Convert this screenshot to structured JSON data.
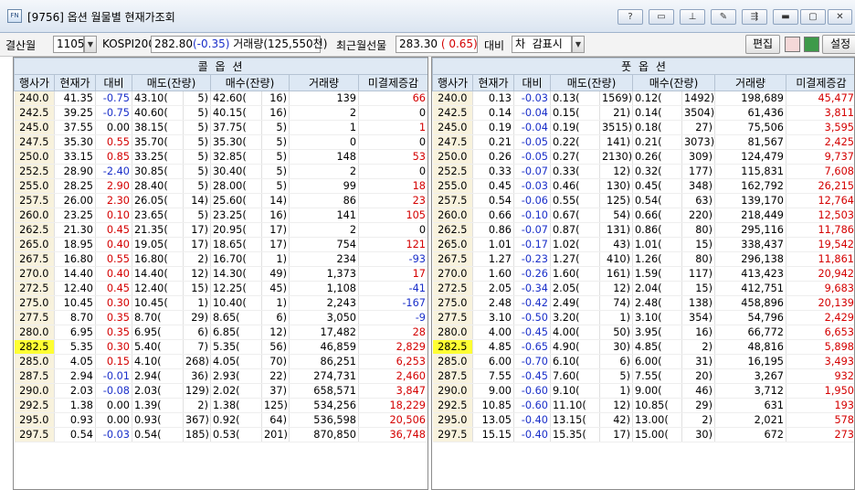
{
  "window": {
    "title": "[9756] 옵션 월물별 현재가조회",
    "app_icon": "window-app-icon"
  },
  "titlebar_buttons": [
    {
      "name": "help",
      "glyph": "?"
    },
    {
      "name": "window",
      "glyph": "▭"
    },
    {
      "name": "pin",
      "glyph": "⊥"
    },
    {
      "name": "tool",
      "glyph": "✎"
    },
    {
      "name": "link",
      "glyph": "⇶"
    },
    {
      "name": "minimize",
      "glyph": "▬"
    },
    {
      "name": "maximize",
      "glyph": "▢"
    },
    {
      "name": "close",
      "glyph": "✕"
    }
  ],
  "toolbar": {
    "expiry_label": "결산월",
    "expiry_value": "1105",
    "kospi_label": "KOSPI200",
    "kospi_value": "282.80",
    "kospi_change": "(-0.35)",
    "kospi_volume": "거래량(125,550천)",
    "nearby_futures_label": "최근월선물",
    "futures_value": "283.30",
    "futures_change": "( 0.65)",
    "compare_label": "대비",
    "compare_mode": "차",
    "display_mode": "감표시",
    "edit_button": "편집",
    "settings_button": "설정"
  },
  "call_banner": "콜 옵 션",
  "put_banner": "풋 옵 션",
  "call_headers": [
    "행사가",
    "현재가",
    "대비",
    "매도(잔량)",
    "매수(잔량)",
    "거래량",
    "미결제증감"
  ],
  "put_headers": [
    "행사가",
    "현재가",
    "대비",
    "매도(잔량)",
    "매수(잔량)",
    "거래량",
    "미결제증감"
  ],
  "atm_strike": "282.5",
  "colors": {
    "up": "#d40000",
    "down": "#1a2fc9",
    "atm_highlight": "#ffff33",
    "strike_bg": "#f8f2dd",
    "header_bg": "#dde8f4"
  },
  "call_rows": [
    [
      "240.0",
      "41.35",
      "-0.75",
      "43.10(",
      "5)",
      "42.60(",
      "16)",
      "139",
      "66"
    ],
    [
      "242.5",
      "39.25",
      "-0.75",
      "40.60(",
      "5)",
      "40.15(",
      "16)",
      "2",
      "0"
    ],
    [
      "245.0",
      "37.55",
      "0.00",
      "38.15(",
      "5)",
      "37.75(",
      "5)",
      "1",
      "1"
    ],
    [
      "247.5",
      "35.30",
      "0.55",
      "35.70(",
      "5)",
      "35.30(",
      "5)",
      "0",
      "0"
    ],
    [
      "250.0",
      "33.15",
      "0.85",
      "33.25(",
      "5)",
      "32.85(",
      "5)",
      "148",
      "53"
    ],
    [
      "252.5",
      "28.90",
      "-2.40",
      "30.85(",
      "5)",
      "30.40(",
      "5)",
      "2",
      "0"
    ],
    [
      "255.0",
      "28.25",
      "2.90",
      "28.40(",
      "5)",
      "28.00(",
      "5)",
      "99",
      "18"
    ],
    [
      "257.5",
      "26.00",
      "2.30",
      "26.05(",
      "14)",
      "25.60(",
      "14)",
      "86",
      "23"
    ],
    [
      "260.0",
      "23.25",
      "0.10",
      "23.65(",
      "5)",
      "23.25(",
      "16)",
      "141",
      "105"
    ],
    [
      "262.5",
      "21.30",
      "0.45",
      "21.35(",
      "17)",
      "20.95(",
      "17)",
      "2",
      "0"
    ],
    [
      "265.0",
      "18.95",
      "0.40",
      "19.05(",
      "17)",
      "18.65(",
      "17)",
      "754",
      "121"
    ],
    [
      "267.5",
      "16.80",
      "0.55",
      "16.80(",
      "2)",
      "16.70(",
      "1)",
      "234",
      "-93"
    ],
    [
      "270.0",
      "14.40",
      "0.40",
      "14.40(",
      "12)",
      "14.30(",
      "49)",
      "1,373",
      "17"
    ],
    [
      "272.5",
      "12.40",
      "0.45",
      "12.40(",
      "15)",
      "12.25(",
      "45)",
      "1,108",
      "-41"
    ],
    [
      "275.0",
      "10.45",
      "0.30",
      "10.45(",
      "1)",
      "10.40(",
      "1)",
      "2,243",
      "-167"
    ],
    [
      "277.5",
      "8.70",
      "0.35",
      "8.70(",
      "29)",
      "8.65(",
      "6)",
      "3,050",
      "-9"
    ],
    [
      "280.0",
      "6.95",
      "0.35",
      "6.95(",
      "6)",
      "6.85(",
      "12)",
      "17,482",
      "28"
    ],
    [
      "282.5",
      "5.35",
      "0.30",
      "5.40(",
      "7)",
      "5.35(",
      "56)",
      "46,859",
      "2,829"
    ],
    [
      "285.0",
      "4.05",
      "0.15",
      "4.10(",
      "268)",
      "4.05(",
      "70)",
      "86,251",
      "6,253"
    ],
    [
      "287.5",
      "2.94",
      "-0.01",
      "2.94(",
      "36)",
      "2.93(",
      "22)",
      "274,731",
      "2,460"
    ],
    [
      "290.0",
      "2.03",
      "-0.08",
      "2.03(",
      "129)",
      "2.02(",
      "37)",
      "658,571",
      "3,847"
    ],
    [
      "292.5",
      "1.38",
      "0.00",
      "1.39(",
      "2)",
      "1.38(",
      "125)",
      "534,256",
      "18,229"
    ],
    [
      "295.0",
      "0.93",
      "0.00",
      "0.93(",
      "367)",
      "0.92(",
      "64)",
      "536,598",
      "20,506"
    ],
    [
      "297.5",
      "0.54",
      "-0.03",
      "0.54(",
      "185)",
      "0.53(",
      "201)",
      "870,850",
      "36,748"
    ]
  ],
  "put_rows": [
    [
      "240.0",
      "0.13",
      "-0.03",
      "0.13(",
      "1569)",
      "0.12(",
      "1492)",
      "198,689",
      "45,477"
    ],
    [
      "242.5",
      "0.14",
      "-0.04",
      "0.15(",
      "21)",
      "0.14(",
      "3504)",
      "61,436",
      "3,811"
    ],
    [
      "245.0",
      "0.19",
      "-0.04",
      "0.19(",
      "3515)",
      "0.18(",
      "27)",
      "75,506",
      "3,595"
    ],
    [
      "247.5",
      "0.21",
      "-0.05",
      "0.22(",
      "141)",
      "0.21(",
      "3073)",
      "81,567",
      "2,425"
    ],
    [
      "250.0",
      "0.26",
      "-0.05",
      "0.27(",
      "2130)",
      "0.26(",
      "309)",
      "124,479",
      "9,737"
    ],
    [
      "252.5",
      "0.33",
      "-0.07",
      "0.33(",
      "12)",
      "0.32(",
      "177)",
      "115,831",
      "7,608"
    ],
    [
      "255.0",
      "0.45",
      "-0.03",
      "0.46(",
      "130)",
      "0.45(",
      "348)",
      "162,792",
      "26,215"
    ],
    [
      "257.5",
      "0.54",
      "-0.06",
      "0.55(",
      "125)",
      "0.54(",
      "63)",
      "139,170",
      "12,764"
    ],
    [
      "260.0",
      "0.66",
      "-0.10",
      "0.67(",
      "54)",
      "0.66(",
      "220)",
      "218,449",
      "12,503"
    ],
    [
      "262.5",
      "0.86",
      "-0.07",
      "0.87(",
      "131)",
      "0.86(",
      "80)",
      "295,116",
      "11,786"
    ],
    [
      "265.0",
      "1.01",
      "-0.17",
      "1.02(",
      "43)",
      "1.01(",
      "15)",
      "338,437",
      "19,542"
    ],
    [
      "267.5",
      "1.27",
      "-0.23",
      "1.27(",
      "410)",
      "1.26(",
      "80)",
      "296,138",
      "11,861"
    ],
    [
      "270.0",
      "1.60",
      "-0.26",
      "1.60(",
      "161)",
      "1.59(",
      "117)",
      "413,423",
      "20,942"
    ],
    [
      "272.5",
      "2.05",
      "-0.34",
      "2.05(",
      "12)",
      "2.04(",
      "15)",
      "412,751",
      "9,683"
    ],
    [
      "275.0",
      "2.48",
      "-0.42",
      "2.49(",
      "74)",
      "2.48(",
      "138)",
      "458,896",
      "20,139"
    ],
    [
      "277.5",
      "3.10",
      "-0.50",
      "3.20(",
      "1)",
      "3.10(",
      "354)",
      "54,796",
      "2,429"
    ],
    [
      "280.0",
      "4.00",
      "-0.45",
      "4.00(",
      "50)",
      "3.95(",
      "16)",
      "66,772",
      "6,653"
    ],
    [
      "282.5",
      "4.85",
      "-0.65",
      "4.90(",
      "30)",
      "4.85(",
      "2)",
      "48,816",
      "5,898"
    ],
    [
      "285.0",
      "6.00",
      "-0.70",
      "6.10(",
      "6)",
      "6.00(",
      "31)",
      "16,195",
      "3,493"
    ],
    [
      "287.5",
      "7.55",
      "-0.45",
      "7.60(",
      "5)",
      "7.55(",
      "20)",
      "3,267",
      "932"
    ],
    [
      "290.0",
      "9.00",
      "-0.60",
      "9.10(",
      "1)",
      "9.00(",
      "46)",
      "3,712",
      "1,950"
    ],
    [
      "292.5",
      "10.85",
      "-0.60",
      "11.10(",
      "12)",
      "10.85(",
      "29)",
      "631",
      "193"
    ],
    [
      "295.0",
      "13.05",
      "-0.40",
      "13.15(",
      "42)",
      "13.00(",
      "2)",
      "2,021",
      "578"
    ],
    [
      "297.5",
      "15.15",
      "-0.40",
      "15.35(",
      "17)",
      "15.00(",
      "30)",
      "672",
      "273"
    ]
  ]
}
